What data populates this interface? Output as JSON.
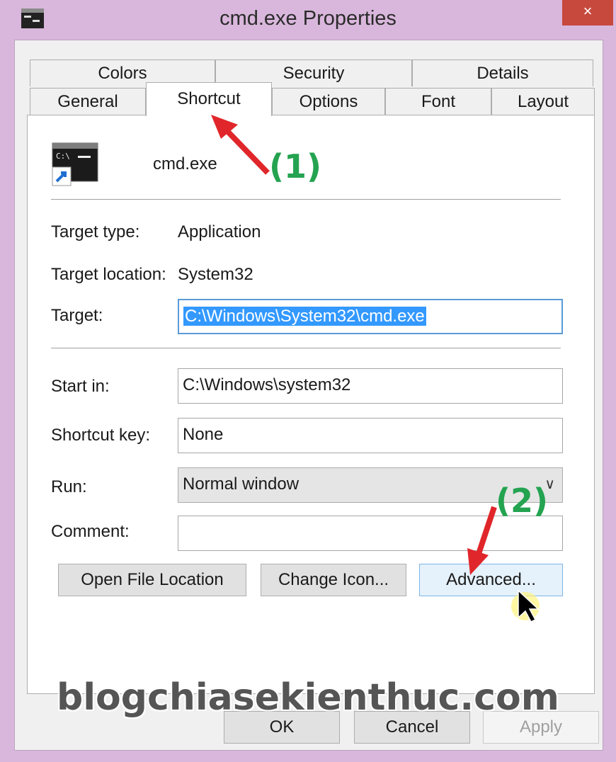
{
  "window": {
    "title": "cmd.exe Properties",
    "close_glyph": "×"
  },
  "tabs_row1": [
    {
      "label": "Colors"
    },
    {
      "label": "Security"
    },
    {
      "label": "Details"
    }
  ],
  "tabs_row2": [
    {
      "label": "General"
    },
    {
      "label": "Shortcut"
    },
    {
      "label": "Options"
    },
    {
      "label": "Font"
    },
    {
      "label": "Layout"
    }
  ],
  "active_tab": "Shortcut",
  "shortcut": {
    "name": "cmd.exe",
    "icon": "cmd-shortcut-icon",
    "target_type_label": "Target type:",
    "target_type_value": "Application",
    "target_location_label": "Target location:",
    "target_location_value": "System32",
    "target_label": "Target:",
    "target_value": "C:\\Windows\\System32\\cmd.exe",
    "start_in_label": "Start in:",
    "start_in_value": "C:\\Windows\\system32",
    "shortcut_key_label": "Shortcut key:",
    "shortcut_key_value": "None",
    "run_label": "Run:",
    "run_value": "Normal window",
    "comment_label": "Comment:",
    "comment_value": ""
  },
  "buttons": {
    "open_file_location": "Open File Location",
    "change_icon": "Change Icon...",
    "advanced": "Advanced...",
    "ok": "OK",
    "cancel": "Cancel",
    "apply": "Apply"
  },
  "annotations": {
    "step1": "(1)",
    "step2": "(2)"
  },
  "watermark": "blogchiasekienthuc.com",
  "colors": {
    "accent": "#3399ff",
    "annotation_green": "#24a350",
    "arrow_red": "#e0262a",
    "titlebar": "#d9b7dc"
  }
}
